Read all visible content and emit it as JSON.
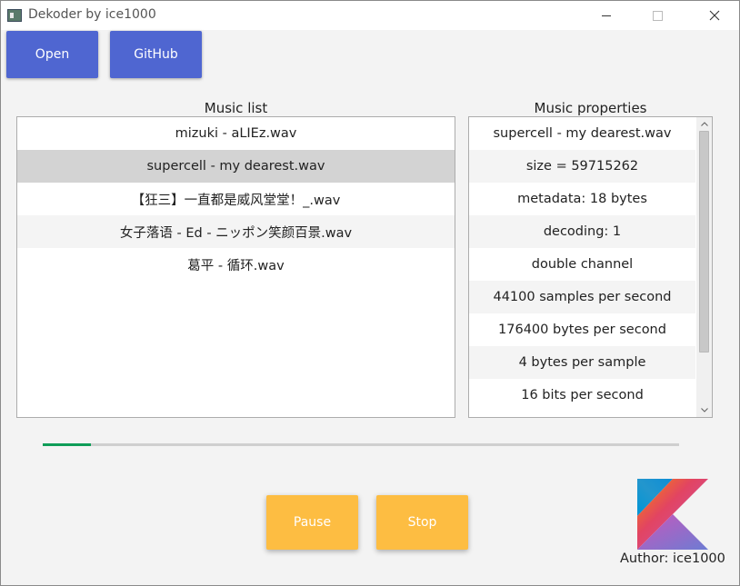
{
  "window": {
    "title": "Dekoder by ice1000"
  },
  "toolbar": {
    "open_label": "Open",
    "github_label": "GitHub"
  },
  "music_list": {
    "label": "Music list",
    "items": [
      "mizuki - aLIEz.wav",
      "supercell - my dearest.wav",
      "【狂三】一直都是威风堂堂！_.wav",
      "女子落语 - Ed - ニッポン笑颜百景.wav",
      "葛平 - 循环.wav"
    ],
    "selected_index": 1
  },
  "properties": {
    "label": "Music properties",
    "items": [
      "supercell - my dearest.wav",
      "size = 59715262",
      "metadata: 18 bytes",
      "decoding: 1",
      "double channel",
      "44100 samples per second",
      "176400 bytes per second",
      "4 bytes per sample",
      "16 bits per second"
    ]
  },
  "progress": {
    "fraction": 0.075,
    "color": "#0f9d58"
  },
  "controls": {
    "pause_label": "Pause",
    "stop_label": "Stop"
  },
  "author": {
    "text": "Author: ice1000",
    "logo_icon": "kotlin-logo-icon"
  },
  "colors": {
    "primary_button": "#4f66d1",
    "accent_button": "#fdbd42"
  }
}
